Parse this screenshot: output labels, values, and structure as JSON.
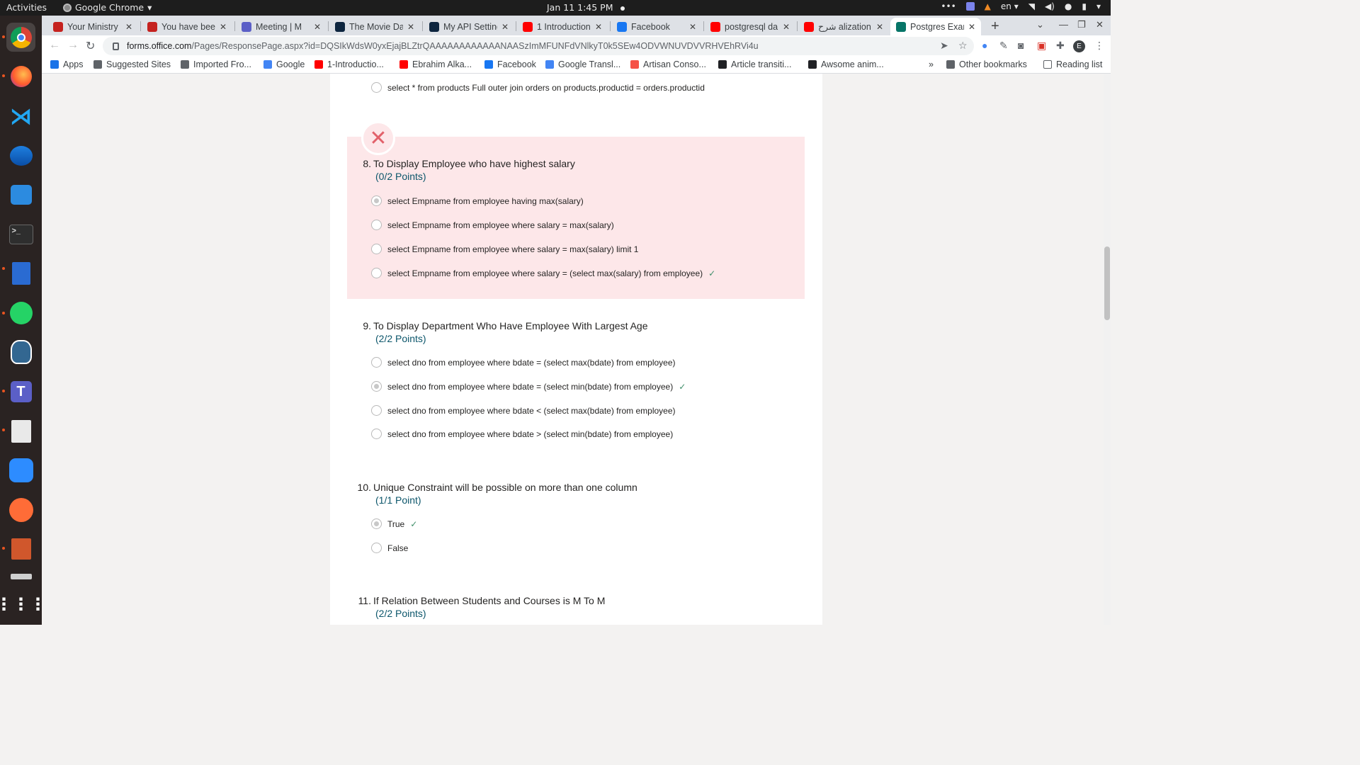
{
  "os": {
    "activities": "Activities",
    "app_name": "Google Chrome",
    "clock": "Jan 11  1:45 PM",
    "lang": "en"
  },
  "browser": {
    "tabs": [
      {
        "title": "Your Ministry",
        "color": "#c5221f"
      },
      {
        "title": "You have been",
        "color": "#c5221f"
      },
      {
        "title": "Meeting | M",
        "color": "#5b5fc7"
      },
      {
        "title": "The Movie Dat",
        "color": "#0d253f"
      },
      {
        "title": "My API Setting",
        "color": "#0d253f"
      },
      {
        "title": "1 Introduction",
        "color": "#ff0000"
      },
      {
        "title": "Facebook",
        "color": "#1877f2"
      },
      {
        "title": "postgresql da",
        "color": "#ff0000"
      },
      {
        "title": "شرح alization",
        "color": "#ff0000"
      },
      {
        "title": "Postgres Exan",
        "color": "#077568"
      }
    ],
    "url_host": "forms.office.com",
    "url_path": "/Pages/ResponsePage.aspx?id=DQSIkWdsW0yxEjajBLZtrQAAAAAAAAAAAANAASzImMFUNFdVNlkyT0k5SEw4ODVWNUVDVVRHVEhRVi4u",
    "avatar_letter": "E",
    "bookmarks": [
      "Apps",
      "Suggested Sites",
      "Imported Fro...",
      "Google",
      "1-Introductio...",
      "Ebrahim Alka...",
      "Facebook",
      "Google Transl...",
      "Artisan Conso...",
      "Article transiti...",
      "Awsome anim..."
    ],
    "overflow": "»",
    "other_bookmarks": "Other bookmarks",
    "reading_list": "Reading list"
  },
  "form": {
    "prev_option": "select * from products Full outer join orders on products.productid = orders.productid",
    "questions": [
      {
        "number": "8.",
        "title": "To Display Employee who have highest salary",
        "points": "(0/2 Points)",
        "options": [
          "select Empname from employee having max(salary)",
          "select Empname from employee where salary = max(salary)",
          "select Empname from employee where salary = max(salary) limit 1",
          "select Empname from employee where salary = (select max(salary) from employee)"
        ]
      },
      {
        "number": "9.",
        "title": "To Display Department Who Have Employee With Largest Age",
        "points": "(2/2 Points)",
        "options": [
          "select dno from employee where bdate = (select max(bdate) from employee)",
          "select dno from employee where bdate = (select min(bdate) from employee)",
          "select dno from employee where bdate < (select max(bdate) from employee)",
          "select dno from employee where bdate > (select min(bdate) from employee)"
        ]
      },
      {
        "number": "10.",
        "title": "Unique Constraint will be possible on more than one column",
        "points": "(1/1 Point)",
        "options": [
          "True",
          "False"
        ]
      },
      {
        "number": "11.",
        "title": "If Relation Between Students and Courses is M To M",
        "points": "(2/2 Points)"
      }
    ],
    "colors": {
      "wrong_bg": "#fde7e9",
      "wrong_mark": "#e2616a",
      "points": "#0b556a",
      "check": "#3f8f6a"
    }
  }
}
